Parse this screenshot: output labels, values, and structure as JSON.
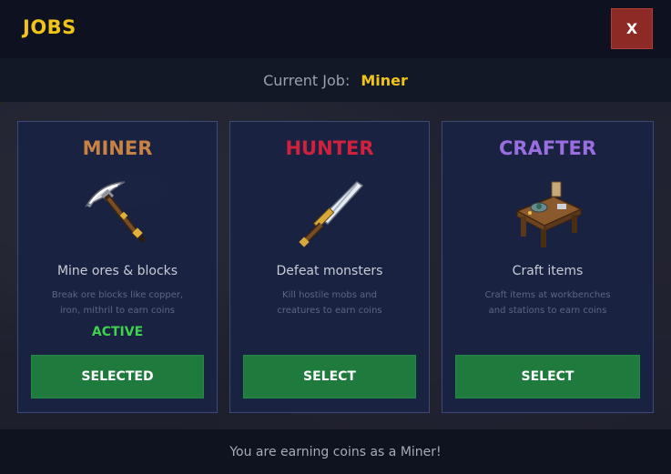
{
  "window": {
    "title": "JOBS",
    "close_label": "X"
  },
  "current": {
    "label": "Current Job:",
    "value": "Miner"
  },
  "jobs": [
    {
      "name": "MINER",
      "name_color": "#c88344",
      "icon": "pickaxe-icon",
      "short": "Mine ores & blocks",
      "desc_line1": "Break ore blocks like copper,",
      "desc_line2": "iron, mithril to earn coins",
      "status": "ACTIVE",
      "button": "SELECTED"
    },
    {
      "name": "HUNTER",
      "name_color": "#d0213e",
      "icon": "sword-icon",
      "short": "Defeat monsters",
      "desc_line1": "Kill hostile mobs and",
      "desc_line2": "creatures to earn coins",
      "status": "",
      "button": "SELECT"
    },
    {
      "name": "CRAFTER",
      "name_color": "#9a6ee0",
      "icon": "workbench-icon",
      "short": "Craft items",
      "desc_line1": "Craft items at workbenches",
      "desc_line2": "and stations to earn coins",
      "status": "",
      "button": "SELECT"
    }
  ],
  "footer": {
    "message": "You are earning coins as a Miner!"
  }
}
